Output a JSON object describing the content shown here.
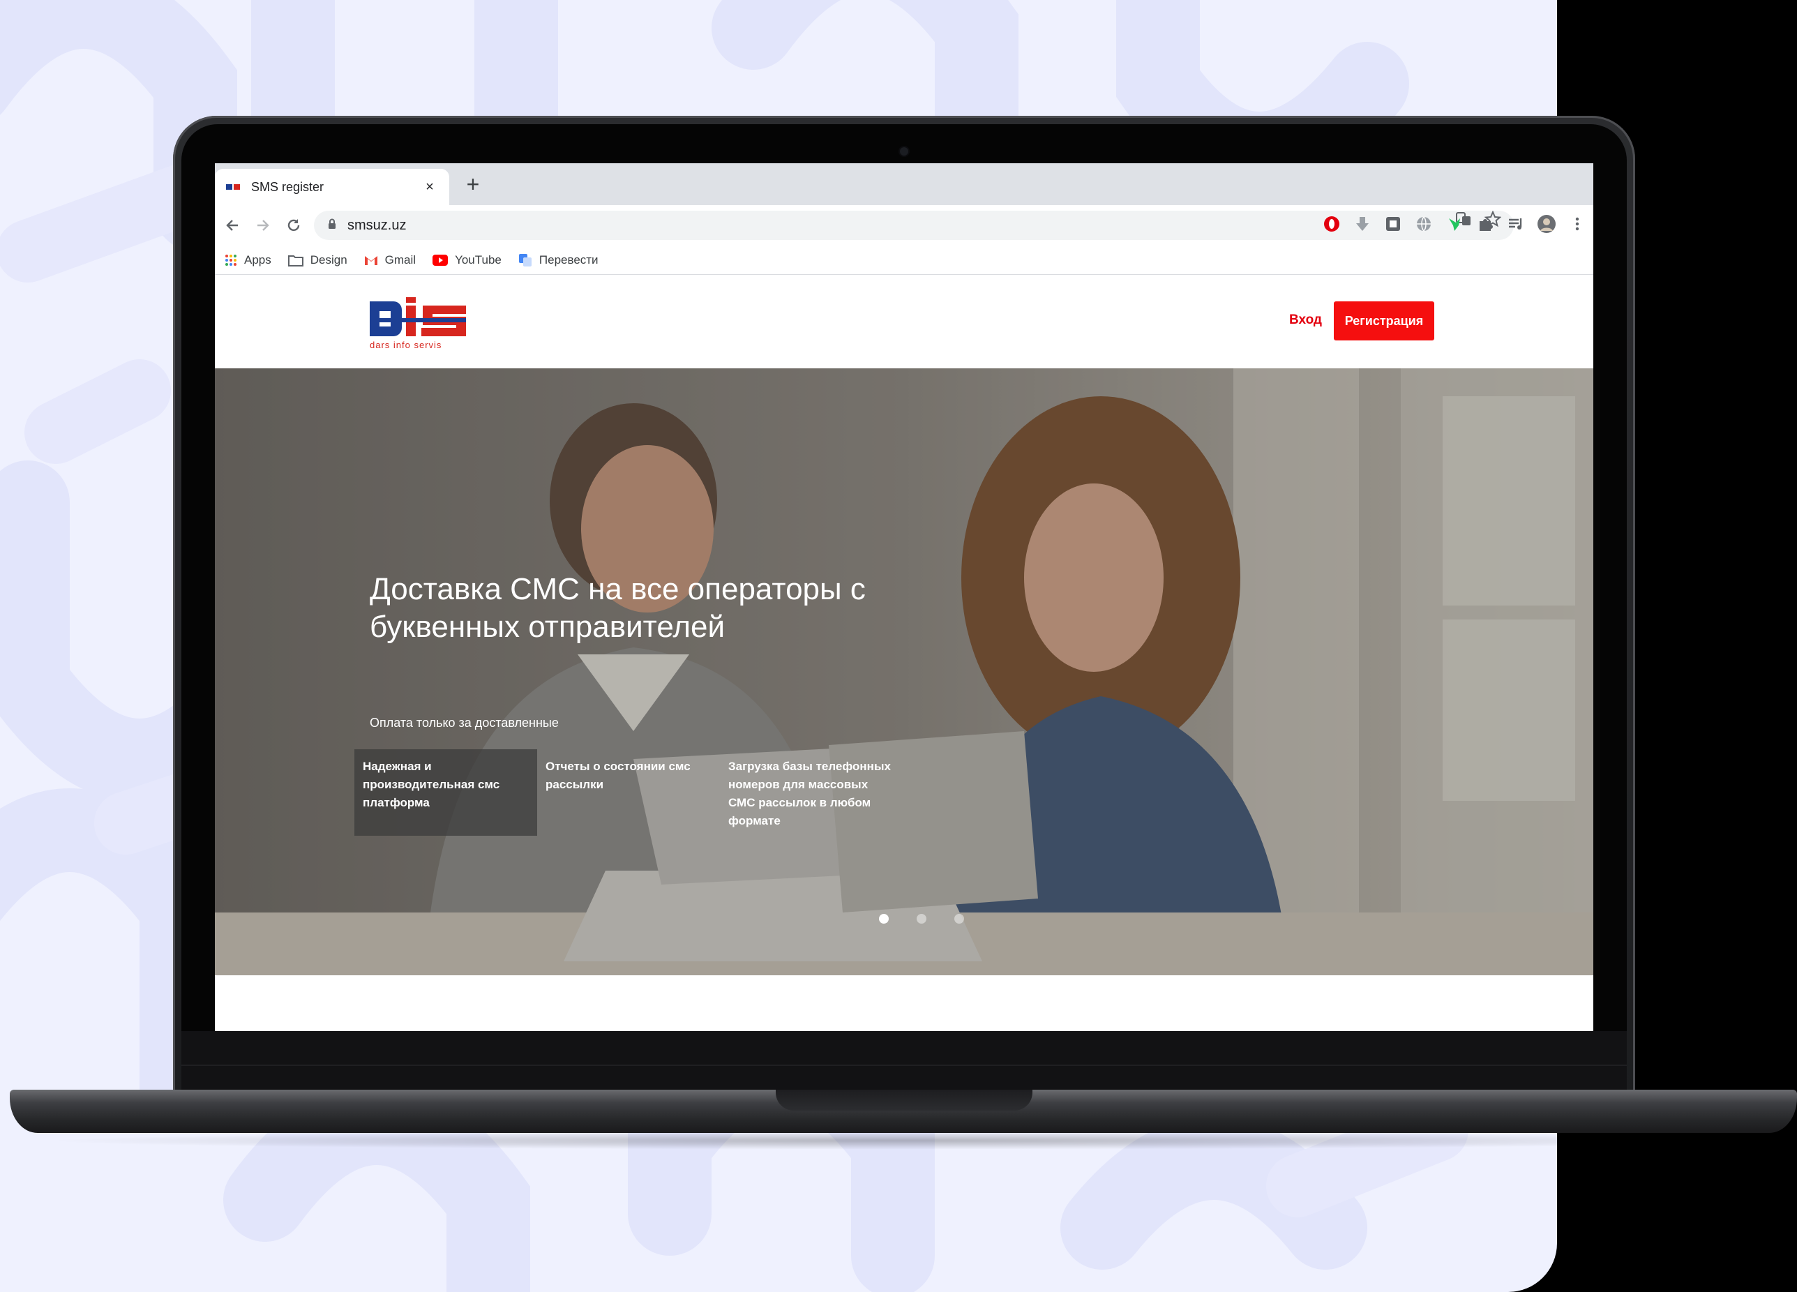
{
  "browser": {
    "tab_title": "SMS register",
    "tab_close": "×",
    "new_tab": "+",
    "url": "smsuz.uz",
    "bookmarks": [
      {
        "label": "Apps",
        "icon": "apps-grid-icon"
      },
      {
        "label": "Design",
        "icon": "folder-icon"
      },
      {
        "label": "Gmail",
        "icon": "gmail-icon"
      },
      {
        "label": "YouTube",
        "icon": "youtube-icon"
      },
      {
        "label": "Перевести",
        "icon": "translate-icon"
      }
    ]
  },
  "site": {
    "logo_text": "dars info servis",
    "nav": {
      "login": "Вход",
      "register": "Регистрация"
    },
    "hero": {
      "title": "Доставка СМС на все операторы с буквенных отправителей",
      "subtitle": "Оплата только за доставленные",
      "features": [
        "Надежная и производительная смс платформа",
        "Отчеты о состоянии смс рассылки",
        "Загрузка базы телефонных номеров для массовых СМС рассылок в любом формате"
      ],
      "active_slide": 1,
      "slide_count": 3
    }
  },
  "colors": {
    "brand_red": "#f50f0f",
    "logo_blue": "#1c3f94",
    "logo_red": "#d7261e",
    "background_panel": "#eff1fe"
  }
}
